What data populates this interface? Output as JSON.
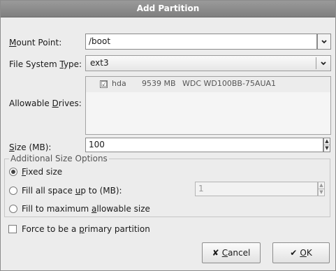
{
  "window": {
    "title": "Add Partition"
  },
  "mount_point": {
    "label_u": "M",
    "label_rest": "ount Point:",
    "value": "/boot",
    "arrow": "chevron-down"
  },
  "fs_type": {
    "label_pre": "File System ",
    "label_u": "T",
    "label_rest": "ype:",
    "value": "ext3"
  },
  "drives": {
    "label_pre": "Allowable ",
    "label_u": "D",
    "label_rest": "rives:",
    "rows": [
      {
        "checked": true,
        "check": "☑",
        "name": "hda",
        "size": "9539 MB",
        "model": "WDC WD100BB-75AUA1"
      }
    ]
  },
  "size": {
    "label_u": "S",
    "label_rest": "ize (MB):",
    "value": "100"
  },
  "additional": {
    "title": "Additional Size Options",
    "fixed": {
      "selected": true,
      "label_u": "F",
      "label_rest": "ixed size"
    },
    "fill_up": {
      "selected": false,
      "label_pre": "Fill all space ",
      "label_u": "u",
      "label_rest": "p to (MB):",
      "value": "1"
    },
    "fill_max": {
      "selected": false,
      "label_pre": "Fill to maximum ",
      "label_u": "a",
      "label_rest": "llowable size"
    }
  },
  "primary": {
    "checked": false,
    "label_pre": "Force to be a ",
    "label_u": "p",
    "label_rest": "rimary partition"
  },
  "buttons": {
    "cancel": {
      "icon": "✘",
      "label_u": "C",
      "label_rest": "ancel"
    },
    "ok": {
      "icon": "✔",
      "label_u": "O",
      "label_rest": "K"
    }
  }
}
